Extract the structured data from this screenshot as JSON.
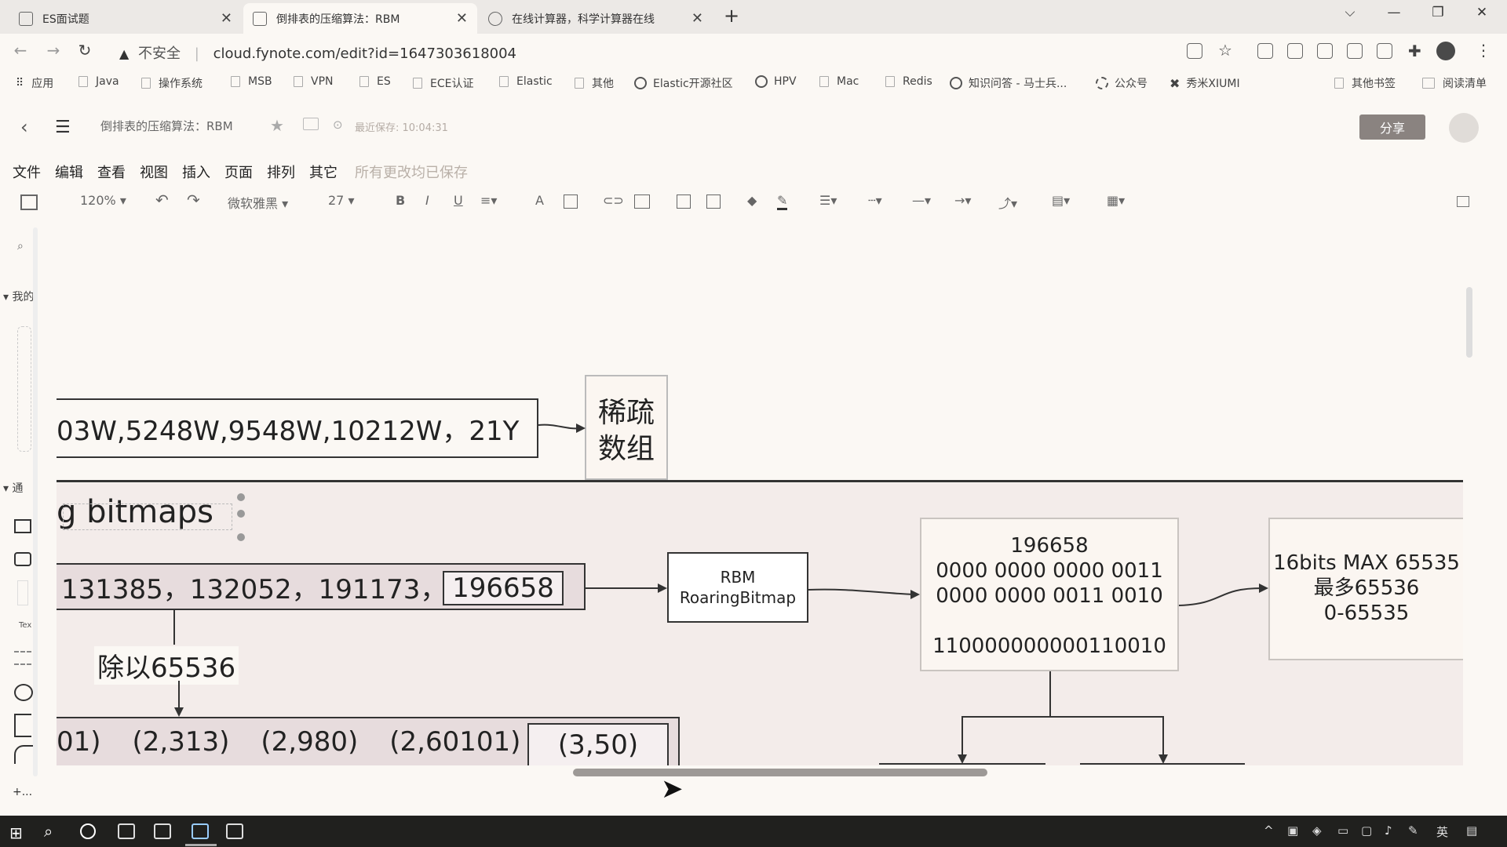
{
  "tabs": [
    {
      "title": "ES面试题",
      "active": false
    },
    {
      "title": "倒排表的压缩算法：RBM",
      "active": true
    },
    {
      "title": "在线计算器，科学计算器在线",
      "active": false
    }
  ],
  "new_tab": "+",
  "address": {
    "warn_icon": "warning-icon",
    "insecure": "不安全",
    "url": "cloud.fynote.com/edit?id=1647303618004"
  },
  "bookmarks": [
    "应用",
    "Java",
    "操作系统",
    "MSB",
    "VPN",
    "ES",
    "ECE认证",
    "Elastic",
    "其他",
    "Elastic开源社区",
    "HPV",
    "Mac",
    "Redis",
    "知识问答 - 马士兵...",
    "公众号",
    "秀米XIUMI"
  ],
  "bookmarks_right": [
    "其他书签",
    "阅读清单"
  ],
  "app": {
    "doc_title": "倒排表的压缩算法：RBM",
    "save_status": "最近保存: 10:04:31",
    "share": "分享"
  },
  "menu": [
    "文件",
    "编辑",
    "查看",
    "视图",
    "插入",
    "页面",
    "排列",
    "其它"
  ],
  "menu_status": "所有更改均已保存",
  "toolbar": {
    "zoom": "120%",
    "font": "微软雅黑",
    "font_size": "27",
    "bold": "B",
    "italic": "I",
    "underline": "U",
    "font_color": "A"
  },
  "left_panel": {
    "section1": "我的",
    "section2": "通",
    "text_tool": "Tex",
    "more": "+..."
  },
  "diagram": {
    "row1_text": "03W,5248W,9548W,10212W，21Y",
    "sparse_line1": "稀疏",
    "sparse_line2": "数组",
    "heading": "g bitmaps",
    "row2_text": "131385，132052，191173，",
    "row2_box": "196658",
    "rbm_line1": "RBM",
    "rbm_line2": "RoaringBitmap",
    "bin_note": [
      "196658",
      "0000 0000 0000 0011",
      "0000 0000 0011 0010",
      "",
      "110000000000110010"
    ],
    "max_note": [
      "16bits MAX 65535",
      "最多65536",
      "0-65535"
    ],
    "divide_label": "除以65536",
    "pairs": [
      "01)",
      "(2,313)",
      "(2,980)",
      "(2,60101)"
    ],
    "pair_box": "(3,50)"
  },
  "taskbar": {
    "ime": "英"
  }
}
